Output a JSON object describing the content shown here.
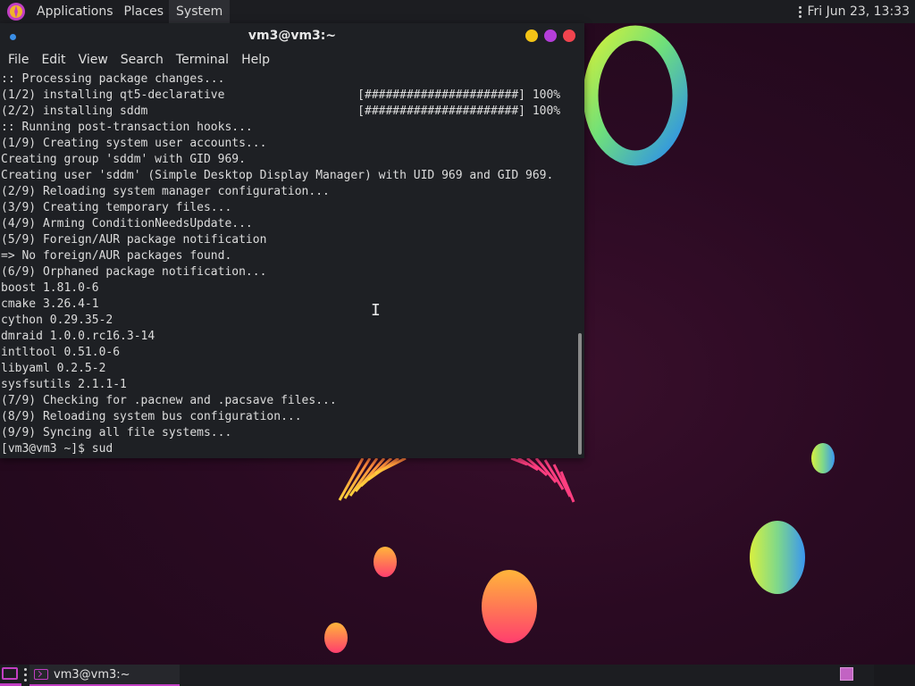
{
  "top_panel": {
    "menus": [
      "Applications",
      "Places",
      "System"
    ],
    "clock": "Fri Jun 23, 13:33"
  },
  "terminal": {
    "title": "vm3@vm3:~",
    "menu": [
      "File",
      "Edit",
      "View",
      "Search",
      "Terminal",
      "Help"
    ],
    "lines": [
      ":: Processing package changes...",
      "(1/2) installing qt5-declarative                   [######################] 100%",
      "(2/2) installing sddm                              [######################] 100%",
      ":: Running post-transaction hooks...",
      "(1/9) Creating system user accounts...",
      "Creating group 'sddm' with GID 969.",
      "Creating user 'sddm' (Simple Desktop Display Manager) with UID 969 and GID 969.",
      "(2/9) Reloading system manager configuration...",
      "(3/9) Creating temporary files...",
      "(4/9) Arming ConditionNeedsUpdate...",
      "(5/9) Foreign/AUR package notification",
      "=> No foreign/AUR packages found.",
      "(6/9) Orphaned package notification...",
      "boost 1.81.0-6",
      "cmake 3.26.4-1",
      "cython 0.29.35-2",
      "dmraid 1.0.0.rc16.3-14",
      "intltool 0.51.0-6",
      "libyaml 0.2.5-2",
      "sysfsutils 2.1.1-1",
      "(7/9) Checking for .pacnew and .pacsave files...",
      "(8/9) Reloading system bus configuration...",
      "(9/9) Syncing all file systems...",
      "[vm3@vm3 ~]$ sud"
    ],
    "window_buttons": [
      {
        "name": "minimize",
        "color": "#f3c316"
      },
      {
        "name": "maximize",
        "color": "#b43ed9"
      },
      {
        "name": "close",
        "color": "#f0444e"
      }
    ]
  },
  "taskbar": {
    "task_label": "vm3@vm3:~"
  },
  "colors": {
    "accent": "#c23fc3",
    "panel_bg": "#1c1d21",
    "terminal_bg": "#1e2024"
  }
}
